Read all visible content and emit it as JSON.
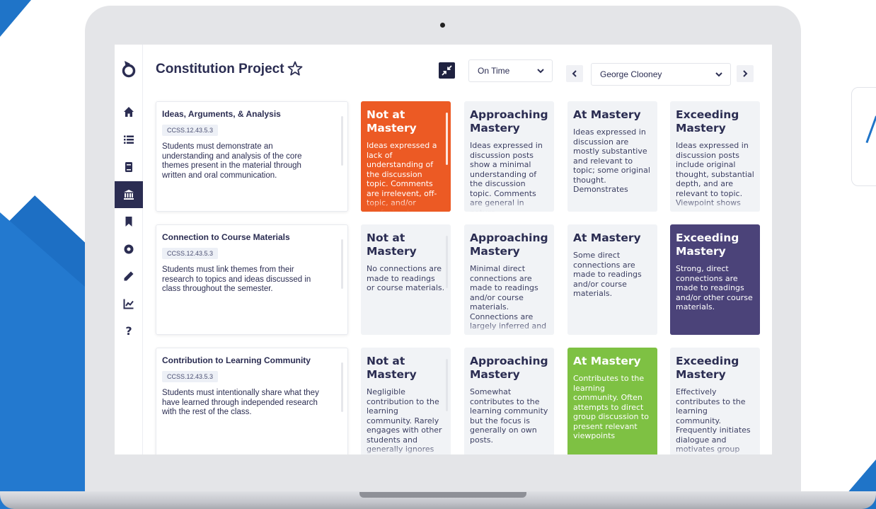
{
  "header": {
    "title": "Constitution Project",
    "status_select": "On Time",
    "student_select": "George Clooney"
  },
  "icons": {
    "logo": "app-logo-icon",
    "star": "star-icon",
    "collapse": "collapse-icon",
    "prev": "chevron-left-icon",
    "next": "chevron-right-icon",
    "nav": [
      "home-icon",
      "list-icon",
      "book-icon",
      "institution-icon",
      "bookmark-icon",
      "record-icon",
      "pencil-icon",
      "chart-icon",
      "help-icon"
    ]
  },
  "colors": {
    "not_mastery_selected": "#ec5a24",
    "exceeding_selected": "#4b4379",
    "at_mastery_selected": "#7ec143",
    "sidebar_active": "#2b2d52"
  },
  "rows": [
    {
      "criterion": "Ideas, Arguments, & Analysis",
      "code": "CCSS.12.43.5.3",
      "description": "Students must demonstrate an understanding and analysis of the core themes present in the material through written and oral communication.",
      "levels": [
        {
          "name": "Not at Mastery",
          "desc": "Ideas expressed a lack of understanding of the discussion topic. Comments are irrelevent, off-topic, and/or confusing to"
        },
        {
          "name": "Approaching Mastery",
          "desc": "Ideas expressed in discussion posts show a minimal understanding of the discussion topic. Comments are general in nature"
        },
        {
          "name": "At Mastery",
          "desc": "Ideas expressed in discussion are mostly substantive and relevant to topic; some original thought. Demonstrates"
        },
        {
          "name": "Exceeding Mastery",
          "desc": "Ideas expressed in discussion posts include original thought, substantial depth, and are relevant to topic. Viewpoint shows"
        }
      ],
      "selected": 0
    },
    {
      "criterion": "Connection to Course Materials",
      "code": "CCSS.12.43.5.3",
      "description": "Students must link themes from their research to topics and ideas discussed in class throughout the semester.",
      "levels": [
        {
          "name": "Not at Mastery",
          "desc": "No connections are made to readings or course materials."
        },
        {
          "name": "Approaching Mastery",
          "desc": "Minimal direct connections are made to readings and/or course materials. Connections are largely inferred and"
        },
        {
          "name": "At Mastery",
          "desc": "Some direct connections are made to readings and/or course materials."
        },
        {
          "name": "Exceeding Mastery",
          "desc": "Strong, direct connections are made to readings and/or other course materials."
        }
      ],
      "selected": 3
    },
    {
      "criterion": "Contribution to Learning Community",
      "code": "CCSS.12.43.5.3",
      "description": "Students must intentionally share what they have learned through independed research with the rest of the class.",
      "levels": [
        {
          "name": "Not at Mastery",
          "desc": "Negligible contribution to the learning community. Rarely engages with other students and generally ignores others' posts and/or"
        },
        {
          "name": "Approaching Mastery",
          "desc": "Somewhat contributes to the learning community but the focus is generally on own posts."
        },
        {
          "name": "At Mastery",
          "desc": "Contributes to the learning community. Often attempts to direct group discussion to present relevant viewpoints"
        },
        {
          "name": "Exceeding Mastery",
          "desc": "Effectively contributes to the learning community. Frequently initiates dialogue and motivates group discussion by"
        }
      ],
      "selected": 2
    }
  ]
}
